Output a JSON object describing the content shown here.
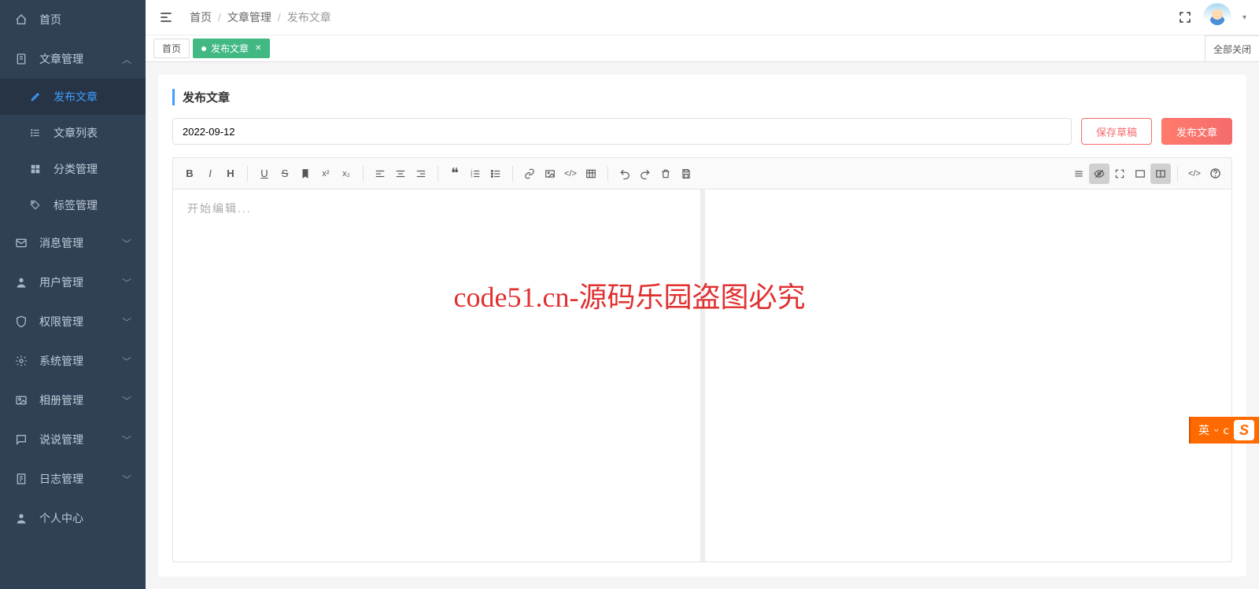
{
  "sidebar": {
    "items": [
      {
        "icon": "home",
        "label": "首页",
        "type": "link"
      },
      {
        "icon": "doc",
        "label": "文章管理",
        "type": "group",
        "expanded": true,
        "children": [
          {
            "icon": "edit",
            "label": "发布文章",
            "active": true
          },
          {
            "icon": "list",
            "label": "文章列表"
          },
          {
            "icon": "grid",
            "label": "分类管理"
          },
          {
            "icon": "tag",
            "label": "标签管理"
          }
        ]
      },
      {
        "icon": "mail",
        "label": "消息管理",
        "type": "group"
      },
      {
        "icon": "user",
        "label": "用户管理",
        "type": "group"
      },
      {
        "icon": "shield",
        "label": "权限管理",
        "type": "group"
      },
      {
        "icon": "gear",
        "label": "系统管理",
        "type": "group"
      },
      {
        "icon": "image",
        "label": "相册管理",
        "type": "group"
      },
      {
        "icon": "chat",
        "label": "说说管理",
        "type": "group"
      },
      {
        "icon": "log",
        "label": "日志管理",
        "type": "group"
      },
      {
        "icon": "person",
        "label": "个人中心",
        "type": "link"
      }
    ]
  },
  "breadcrumb": {
    "items": [
      "首页",
      "文章管理",
      "发布文章"
    ]
  },
  "tabs": {
    "items": [
      {
        "label": "首页",
        "active": false
      },
      {
        "label": "发布文章",
        "active": true,
        "closable": true
      }
    ],
    "close_all": "全部关闭"
  },
  "page": {
    "title": "发布文章",
    "title_input_value": "2022-09-12",
    "save_draft": "保存草稿",
    "publish": "发布文章"
  },
  "editor": {
    "placeholder": "开始编辑...",
    "toolbar": {
      "bold": "B",
      "italic": "I",
      "heading": "H",
      "underline": "U",
      "strike": "S",
      "mark": "mark",
      "sup": "x²",
      "sub": "x₂",
      "align_left": "al",
      "align_center": "ac",
      "align_right": "ar",
      "quote": "q",
      "ol": "ol",
      "ul": "ul",
      "link": "link",
      "image": "img",
      "code": "code",
      "table": "tbl",
      "undo": "undo",
      "redo": "redo",
      "trash": "trash",
      "save": "save",
      "menu": "menu",
      "preview": "preview",
      "fullscreen": "fs",
      "read": "read",
      "split": "split",
      "html": "html",
      "help": "help"
    }
  },
  "watermark": "code51.cn-源码乐园盗图必究",
  "ime": {
    "lang": "英",
    "mode1": "°",
    "mode2": "ⅽ"
  }
}
